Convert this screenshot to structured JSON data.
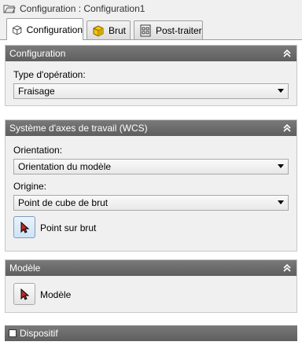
{
  "window": {
    "title": "Configuration : Configuration1",
    "title_icon": "folder-open-icon"
  },
  "tabs": [
    {
      "label": "Configuration",
      "icon": "box-outline-icon",
      "active": true
    },
    {
      "label": "Brut",
      "icon": "yellow-cube-icon",
      "active": false
    },
    {
      "label": "Post-traiter",
      "icon": "post-process-icon",
      "active": false
    }
  ],
  "config_section": {
    "header": "Configuration",
    "operation_type_label": "Type d'opération:",
    "operation_type_value": "Fraisage"
  },
  "wcs_section": {
    "header": "Système d'axes de travail (WCS)",
    "orientation_label": "Orientation:",
    "orientation_value": "Orientation du modèle",
    "origin_label": "Origine:",
    "origin_value": "Point de cube de brut",
    "point_button_label": "Point sur brut"
  },
  "model_section": {
    "header": "Modèle",
    "model_button_label": "Modèle"
  },
  "fixture_section": {
    "header": "Dispositif",
    "checked": false
  },
  "colors": {
    "section_header": "#6b6b6b",
    "cursor_red": "#c0282d",
    "accent_yellow": "#f5c400"
  }
}
